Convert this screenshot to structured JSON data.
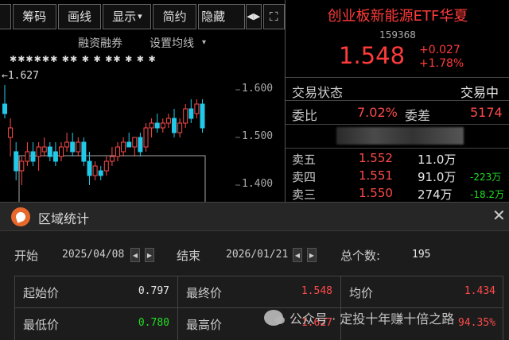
{
  "toolbar": {
    "buttons": [
      "筹码",
      "画线",
      "显示",
      "简约",
      "隐藏"
    ],
    "dropdown_caret": "▾",
    "arrows": "◀▶",
    "expand_icon": "⛶"
  },
  "chart": {
    "header_links": [
      "融资融券",
      "设置均线"
    ],
    "reference_price_label": "←1.627",
    "price_axis": [
      "1.600",
      "1.500",
      "1.400"
    ],
    "event_markers": "✱✱✱✱✱✱  ✱✱  ✱   ✱   ✱✱   ✱   ✱   ✱",
    "candles": [
      {
        "o": 1.57,
        "h": 1.61,
        "l": 1.54,
        "c": 1.55
      },
      {
        "o": 1.5,
        "h": 1.54,
        "l": 1.46,
        "c": 1.52
      },
      {
        "o": 1.47,
        "h": 1.49,
        "l": 1.41,
        "c": 1.43
      },
      {
        "o": 1.43,
        "h": 1.46,
        "l": 1.4,
        "c": 1.45
      },
      {
        "o": 1.45,
        "h": 1.49,
        "l": 1.44,
        "c": 1.47
      },
      {
        "o": 1.47,
        "h": 1.49,
        "l": 1.44,
        "c": 1.45
      },
      {
        "o": 1.46,
        "h": 1.49,
        "l": 1.43,
        "c": 1.48
      },
      {
        "o": 1.47,
        "h": 1.5,
        "l": 1.46,
        "c": 1.48
      },
      {
        "o": 1.48,
        "h": 1.49,
        "l": 1.45,
        "c": 1.46
      },
      {
        "o": 1.47,
        "h": 1.49,
        "l": 1.44,
        "c": 1.45
      },
      {
        "o": 1.46,
        "h": 1.49,
        "l": 1.45,
        "c": 1.48
      },
      {
        "o": 1.48,
        "h": 1.51,
        "l": 1.47,
        "c": 1.49
      },
      {
        "o": 1.49,
        "h": 1.51,
        "l": 1.46,
        "c": 1.47
      },
      {
        "o": 1.47,
        "h": 1.5,
        "l": 1.46,
        "c": 1.49
      },
      {
        "o": 1.49,
        "h": 1.5,
        "l": 1.44,
        "c": 1.45
      },
      {
        "o": 1.45,
        "h": 1.47,
        "l": 1.4,
        "c": 1.42
      },
      {
        "o": 1.42,
        "h": 1.45,
        "l": 1.41,
        "c": 1.44
      },
      {
        "o": 1.43,
        "h": 1.44,
        "l": 1.41,
        "c": 1.42
      },
      {
        "o": 1.43,
        "h": 1.46,
        "l": 1.42,
        "c": 1.45
      },
      {
        "o": 1.45,
        "h": 1.48,
        "l": 1.44,
        "c": 1.46
      },
      {
        "o": 1.46,
        "h": 1.49,
        "l": 1.45,
        "c": 1.48
      },
      {
        "o": 1.47,
        "h": 1.5,
        "l": 1.46,
        "c": 1.49
      },
      {
        "o": 1.49,
        "h": 1.51,
        "l": 1.48,
        "c": 1.48
      },
      {
        "o": 1.48,
        "h": 1.5,
        "l": 1.46,
        "c": 1.5
      },
      {
        "o": 1.5,
        "h": 1.51,
        "l": 1.46,
        "c": 1.47
      },
      {
        "o": 1.48,
        "h": 1.53,
        "l": 1.47,
        "c": 1.52
      },
      {
        "o": 1.52,
        "h": 1.54,
        "l": 1.5,
        "c": 1.53
      },
      {
        "o": 1.53,
        "h": 1.55,
        "l": 1.51,
        "c": 1.52
      },
      {
        "o": 1.52,
        "h": 1.54,
        "l": 1.51,
        "c": 1.53
      },
      {
        "o": 1.53,
        "h": 1.55,
        "l": 1.52,
        "c": 1.54
      },
      {
        "o": 1.54,
        "h": 1.56,
        "l": 1.5,
        "c": 1.51
      },
      {
        "o": 1.51,
        "h": 1.54,
        "l": 1.5,
        "c": 1.53
      },
      {
        "o": 1.53,
        "h": 1.57,
        "l": 1.52,
        "c": 1.56
      },
      {
        "o": 1.56,
        "h": 1.58,
        "l": 1.53,
        "c": 1.54
      },
      {
        "o": 1.55,
        "h": 1.58,
        "l": 1.54,
        "c": 1.57
      },
      {
        "o": 1.57,
        "h": 1.58,
        "l": 1.51,
        "c": 1.52
      }
    ]
  },
  "quote": {
    "title": "创业板新能源ETF华夏",
    "code": "159368",
    "price": "1.548",
    "change": "+0.027",
    "change_pct": "+1.78%",
    "status_label": "交易状态",
    "status_value": "交易中",
    "weibi_label": "委比",
    "weibi_value": "7.02%",
    "weicha_label": "委差",
    "weicha_value": "5174",
    "order_book": [
      {
        "label": "卖五",
        "price": "1.552",
        "volume": "11.0万",
        "delta": ""
      },
      {
        "label": "卖四",
        "price": "1.551",
        "volume": "91.0万",
        "delta": "-223万"
      },
      {
        "label": "卖三",
        "price": "1.550",
        "volume": "274万",
        "delta": "-18.2万"
      }
    ]
  },
  "dialog": {
    "title": "区域统计",
    "close_icon": "✕",
    "start_label": "开始",
    "start_date": "2025/04/08",
    "end_label": "结束",
    "end_date": "2026/01/21",
    "count_label": "总个数:",
    "count_value": "195",
    "spin_prev": "◀",
    "spin_next": "▶",
    "stats": [
      {
        "label": "起始价",
        "value": "0.797"
      },
      {
        "label": "最终价",
        "value": "1.548"
      },
      {
        "label": "均价",
        "value": "1.434"
      },
      {
        "label": "最低价",
        "value": "0.780"
      },
      {
        "label": "最高价",
        "value": "1.627"
      },
      {
        "label": "",
        "value": "94.35%"
      }
    ]
  },
  "watermark": "公众号 · 定投十年赚十倍之路",
  "colors": {
    "up": "#ff4a4a",
    "down": "#22dd22",
    "neutral": "#e8e8e8",
    "cyan_body": "#22c8e8"
  }
}
